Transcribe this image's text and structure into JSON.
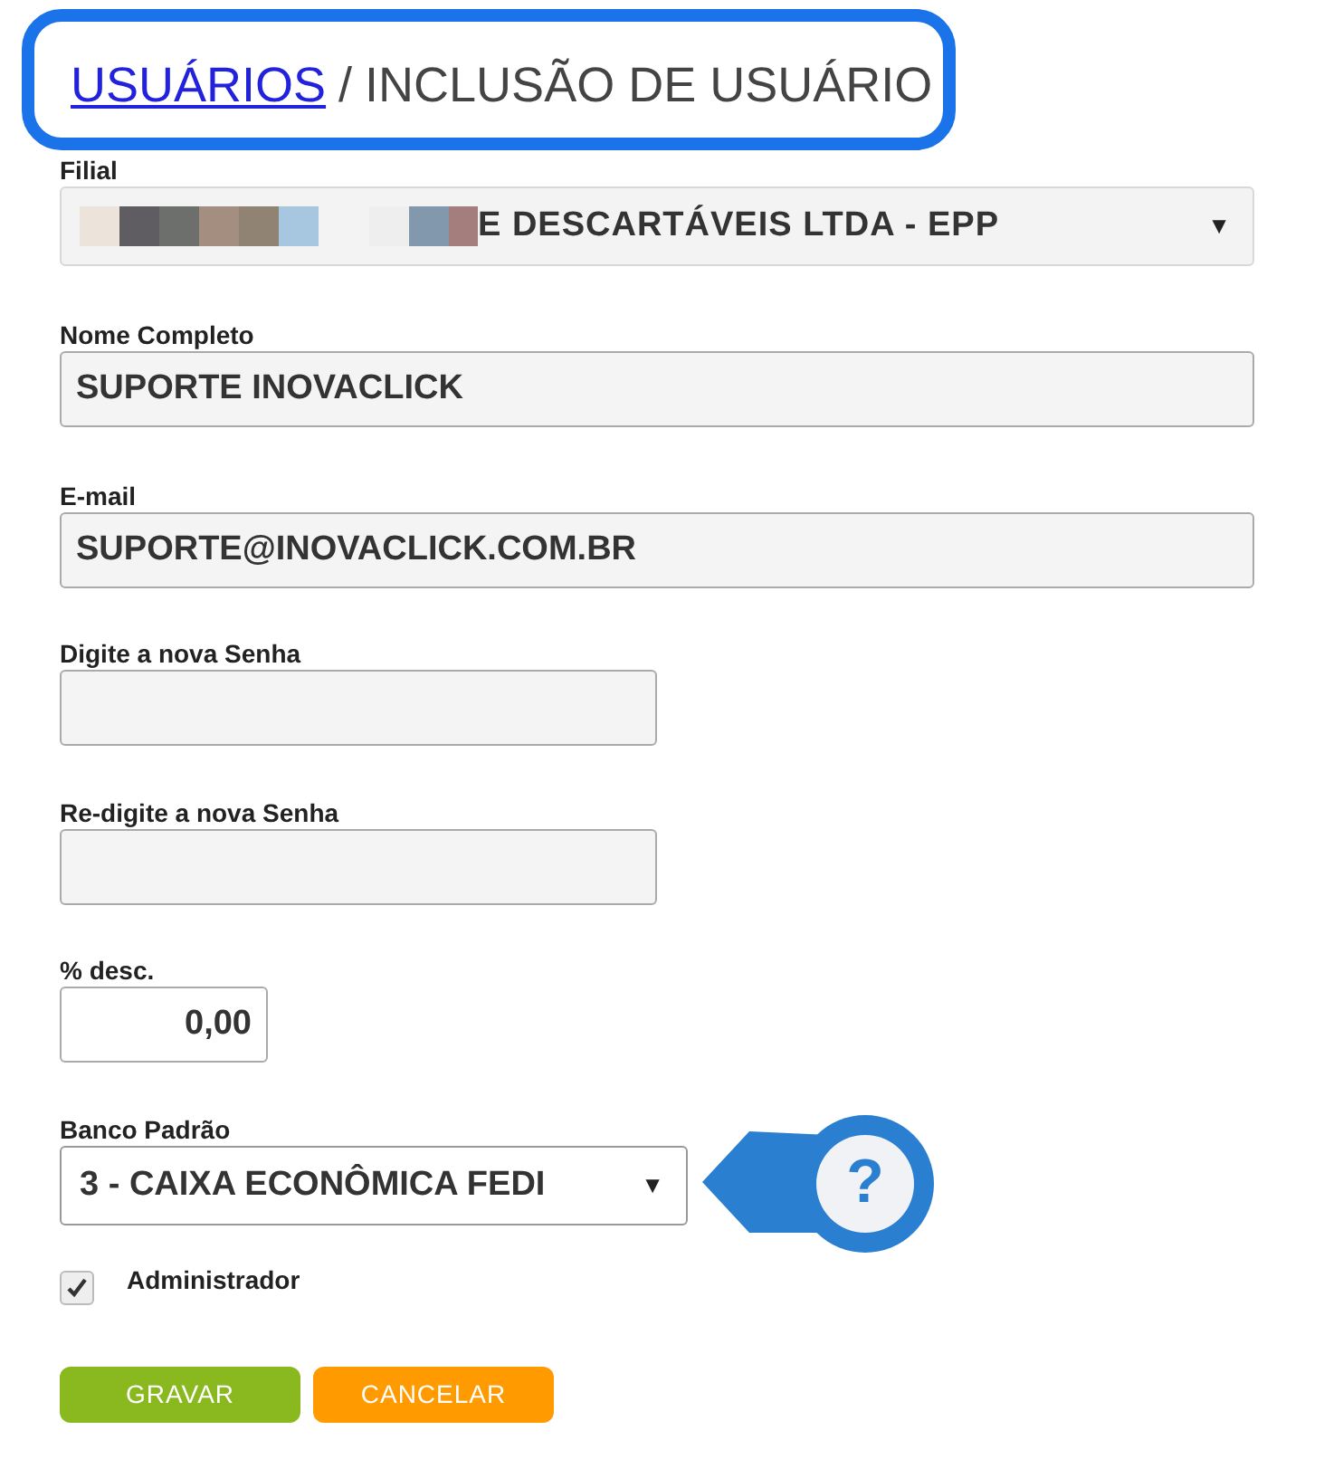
{
  "breadcrumb": {
    "link": "USUÁRIOS",
    "separator": "/",
    "current": "INCLUSÃO DE USUÁRIO"
  },
  "fields": [
    {
      "kind": "select",
      "label": "Filial",
      "value": "E DESCARTÁVEIS LTDA - EPP",
      "redacted": true,
      "arrow": "▼"
    },
    {
      "kind": "text",
      "label": "Nome Completo",
      "value": "SUPORTE INOVACLICK"
    },
    {
      "kind": "text",
      "label": "E-mail",
      "value": "SUPORTE@INOVACLICK.COM.BR"
    },
    {
      "kind": "password",
      "label": "Digite a nova Senha"
    },
    {
      "kind": "password",
      "label": "Re-digite a nova Senha"
    },
    {
      "kind": "number",
      "label": "% desc.",
      "value": "0,00"
    },
    {
      "kind": "select",
      "label": "Banco Padrão",
      "value": "3 - CAIXA ECONÔMICA FEDI",
      "redacted": false,
      "arrow": "▼",
      "help": "?"
    }
  ],
  "administrator": {
    "label": "Administrador",
    "checked": true
  },
  "buttons": [
    {
      "label": "GRAVAR",
      "kind": "save"
    },
    {
      "label": "CANCELAR",
      "kind": "cancel"
    }
  ]
}
